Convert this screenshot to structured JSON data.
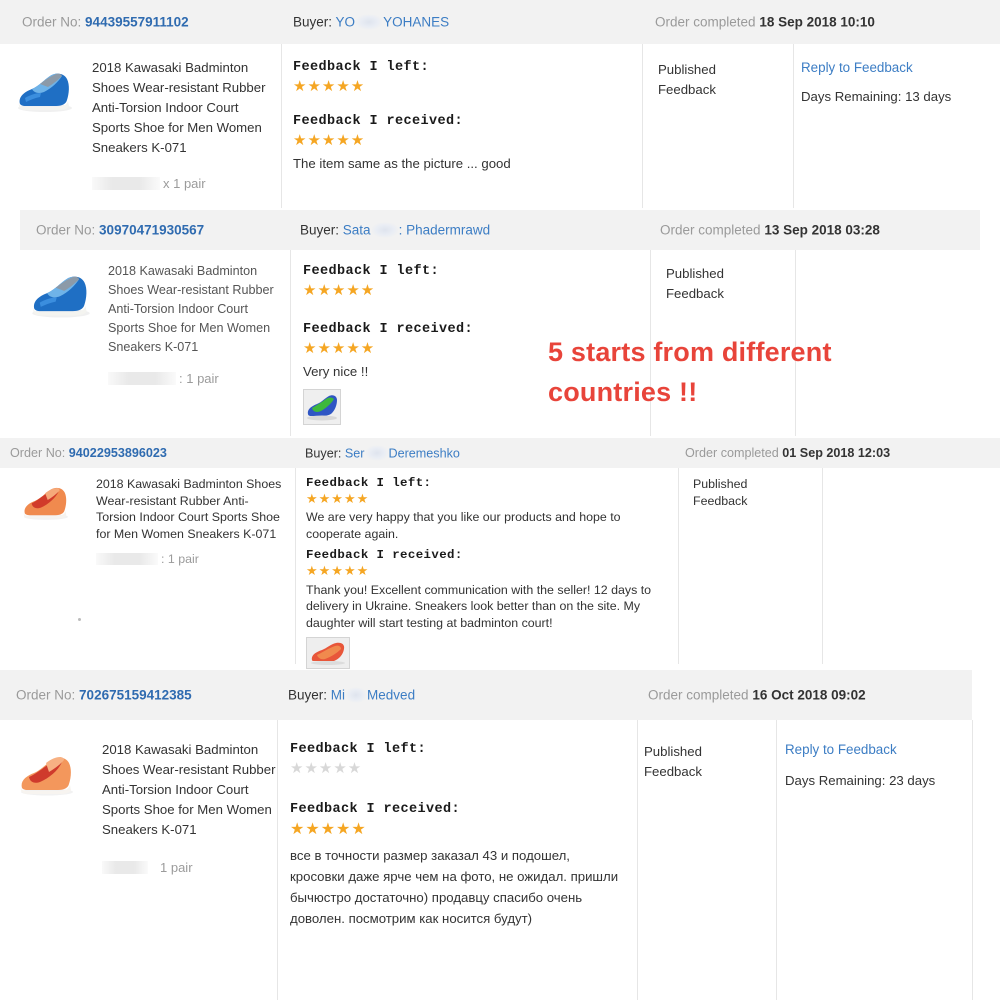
{
  "annotation": {
    "line1": "5 starts from different",
    "line2": "countries !!",
    "color": "#e8443a"
  },
  "labels": {
    "order_no": "Order No:",
    "buyer": "Buyer:",
    "order_completed": "Order completed",
    "feedback_left": "Feedback I left:",
    "feedback_received": "Feedback I received:",
    "published_feedback": "Published\nFeedback",
    "published_feedback_line1": "Published",
    "published_feedback_line2": "Feedback",
    "reply_to_feedback": "Reply to Feedback"
  },
  "product": {
    "title": "2018 Kawasaki Badminton Shoes Wear-resistant Rubber Anti-Torsion Indoor Court Sports Shoe for Men Women Sneakers K-071"
  },
  "orders": [
    {
      "order_no": "94439557911102",
      "buyer_prefix": "YO",
      "buyer_suffix": "YOHANES",
      "completed": "18 Sep 2018 10:10",
      "qty": "x 1 pair",
      "shoe_color": "blue",
      "feedback_left_stars": 5,
      "feedback_left_text": "",
      "feedback_received_stars": 5,
      "feedback_received_text": "The item same as the picture ... good",
      "has_received_photo": false,
      "status": "Published Feedback",
      "reply_link": "Reply to Feedback",
      "days_remaining": "Days Remaining: 13 days",
      "has_reply_column": true
    },
    {
      "order_no": "30970471930567",
      "buyer_prefix": "Sata",
      "buyer_suffix": ": Phadermrawd",
      "completed": "13 Sep 2018 03:28",
      "qty": ": 1 pair",
      "shoe_color": "blue",
      "feedback_left_stars": 5,
      "feedback_left_text": "",
      "feedback_received_stars": 5,
      "feedback_received_text": "Very nice !!",
      "has_received_photo": true,
      "status": "Published Feedback",
      "reply_link": "",
      "days_remaining": "",
      "has_reply_column": false
    },
    {
      "order_no": "94022953896023",
      "buyer_prefix": "Ser",
      "buyer_suffix": "Deremeshko",
      "completed": "01 Sep 2018 12:03",
      "qty": ": 1 pair",
      "shoe_color": "red",
      "feedback_left_stars": 5,
      "feedback_left_text": "We are very happy that you like our products and hope to cooperate again.",
      "feedback_received_stars": 5,
      "feedback_received_text": "Thank you! Excellent communication with the seller! 12 days to delivery in Ukraine. Sneakers look better than on the site. My daughter will start testing at badminton court!",
      "has_received_photo": true,
      "status": "Published Feedback",
      "reply_link": "",
      "days_remaining": "",
      "has_reply_column": false
    },
    {
      "order_no": "702675159412385",
      "buyer_prefix": "Mi",
      "buyer_suffix": "Medved",
      "completed": "16 Oct 2018 09:02",
      "qty": "1 pair",
      "shoe_color": "red",
      "feedback_left_stars": 0,
      "feedback_left_text": "",
      "feedback_received_stars": 5,
      "feedback_received_text": "все в точности размер заказал 43 и подошел, кросовки даже ярче чем на фото, не ожидал. пришли бычюстро достаточно) продавцу спасибо очень доволен. посмотрим как носится будут)",
      "has_received_photo": false,
      "status": "Published Feedback",
      "reply_link": "Reply to Feedback",
      "days_remaining": "Days Remaining: 23 days",
      "has_reply_column": true
    }
  ],
  "icons": {
    "star_filled": "★",
    "star_empty": "★"
  },
  "colors": {
    "link": "#3c7dc4",
    "order_link": "#2f6bb0",
    "star": "#f5a623",
    "star_empty": "#d8d8d8",
    "header_bg": "#f2f2f2",
    "annotation": "#e8443a"
  }
}
